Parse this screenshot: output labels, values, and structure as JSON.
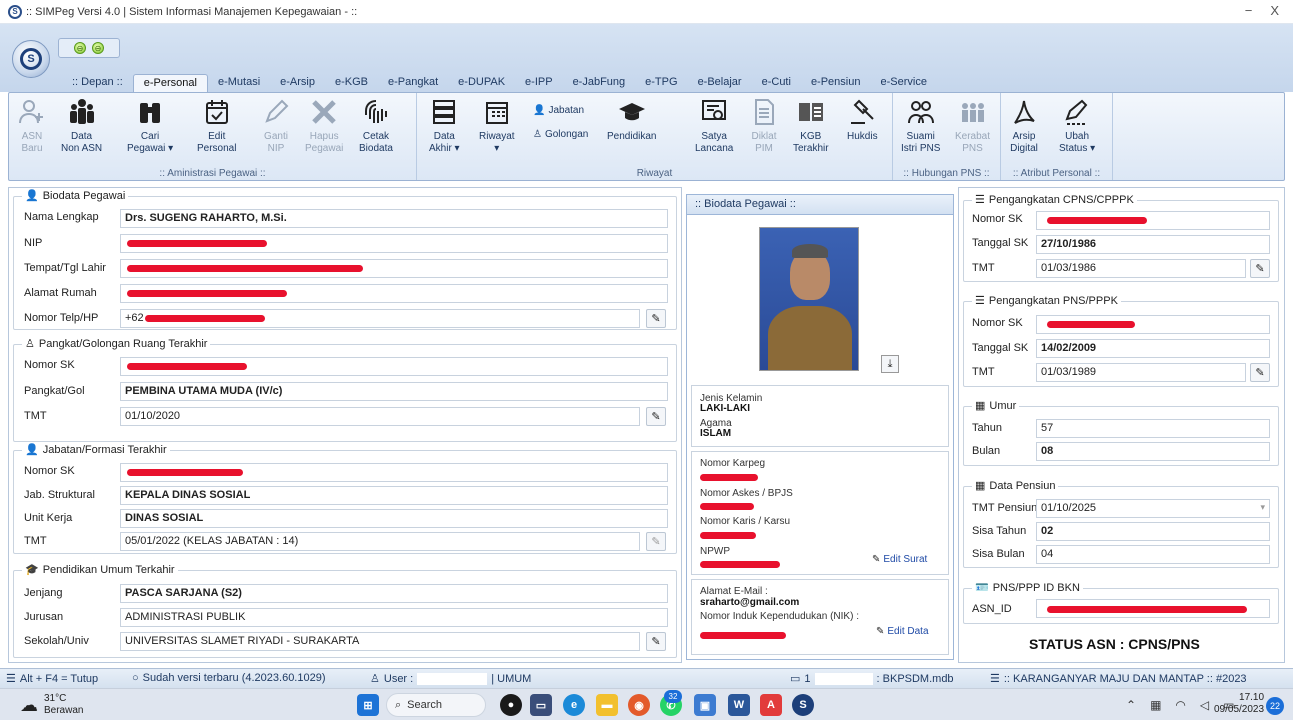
{
  "window": {
    "title": ":: SIMPeg Versi 4.0 | Sistem Informasi Manajemen Kepegawaian - ::",
    "minimize": "−",
    "close": "X"
  },
  "tabs": [
    ":: Depan ::",
    "e-Personal",
    "e-Mutasi",
    "e-Arsip",
    "e-KGB",
    "e-Pangkat",
    "e-DUPAK",
    "e-IPP",
    "e-JabFung",
    "e-TPG",
    "e-Belajar",
    "e-Cuti",
    "e-Pensiun",
    "e-Service"
  ],
  "ribbon": {
    "asn_baru": [
      "ASN",
      "Baru"
    ],
    "data_non_asn": [
      "Data",
      "Non ASN"
    ],
    "cari_pegawai": [
      "Cari",
      "Pegawai ▾"
    ],
    "edit_personal": [
      "Edit",
      "Personal"
    ],
    "ganti_nip": [
      "Ganti",
      "NIP"
    ],
    "hapus_pegawai": [
      "Hapus",
      "Pegawai"
    ],
    "cetak_biodata": [
      "Cetak",
      "Biodata"
    ],
    "data_akhir": [
      "Data",
      "Akhir ▾"
    ],
    "riwayat": [
      "Riwayat",
      "▾"
    ],
    "jabatan": "Jabatan",
    "golongan": "Golongan",
    "pendidikan": "Pendidikan",
    "satya_lancana": [
      "Satya",
      "Lancana"
    ],
    "diklat_pim": [
      "Diklat",
      "PIM"
    ],
    "kgb_terakhir": [
      "KGB",
      "Terakhir"
    ],
    "hukdis": "Hukdis",
    "suami_istri": [
      "Suami",
      "Istri PNS"
    ],
    "kerabat_pns": [
      "Kerabat",
      "PNS"
    ],
    "arsip_digital": [
      "Arsip",
      "Digital"
    ],
    "ubah_status": [
      "Ubah",
      "Status ▾"
    ],
    "group_admin": ":: Aministrasi Pegawai ::",
    "group_riwayat": "Riwayat",
    "group_hubungan": ":: Hubungan PNS ::",
    "group_atribut": ":: Atribut Personal ::"
  },
  "biodata": {
    "legend": "Biodata Pegawai",
    "nama_label": "Nama Lengkap",
    "nama_value": "Drs. SUGENG RAHARTO, M.Si.",
    "nip_label": "NIP",
    "ttl_label": "Tempat/Tgl Lahir",
    "alamat_label": "Alamat Rumah",
    "telp_label": "Nomor Telp/HP",
    "telp_prefix": "+62"
  },
  "pangkat": {
    "legend": "Pangkat/Golongan Ruang Terakhir",
    "sk_label": "Nomor SK",
    "gol_label": "Pangkat/Gol",
    "gol_value": "PEMBINA UTAMA MUDA (IV/c)",
    "tmt_label": "TMT",
    "tmt_value": "01/10/2020"
  },
  "jabatan": {
    "legend": "Jabatan/Formasi Terakhir",
    "sk_label": "Nomor SK",
    "struktural_label": "Jab. Struktural",
    "struktural_value": "KEPALA DINAS SOSIAL",
    "unit_label": "Unit Kerja",
    "unit_value": "DINAS SOSIAL",
    "tmt_label": "TMT",
    "tmt_value": "05/01/2022 (KELAS JABATAN : 14)"
  },
  "pendidikan": {
    "legend": "Pendidikan Umum Terkahir",
    "jenjang_label": "Jenjang",
    "jenjang_value": "PASCA SARJANA (S2)",
    "jurusan_label": "Jurusan",
    "jurusan_value": "ADMINISTRASI PUBLIK",
    "sekolah_label": "Sekolah/Univ",
    "sekolah_value": "UNIVERSITAS SLAMET RIYADI - SURAKARTA"
  },
  "profile": {
    "header": ":: Biodata Pegawai ::",
    "jk_label": "Jenis Kelamin",
    "jk_value": "LAKI-LAKI",
    "agama_label": "Agama",
    "agama_value": "ISLAM",
    "karpeg_label": "Nomor Karpeg",
    "askes_label": "Nomor Askes / BPJS",
    "karis_label": "Nomor Karis / Karsu",
    "npwp_label": "NPWP",
    "edit_surat": "Edit Surat",
    "email_label": "Alamat E-Mail :",
    "email_value": "sraharto@gmail.com",
    "nik_label": "Nomor Induk Kependudukan (NIK) :",
    "edit_data": "Edit Data"
  },
  "cpns": {
    "legend": "Pengangkatan CPNS/CPPPK",
    "sk_label": "Nomor SK",
    "tgl_label": "Tanggal SK",
    "tgl_value": "27/10/1986",
    "tmt_label": "TMT",
    "tmt_value": "01/03/1986"
  },
  "pns": {
    "legend": "Pengangkatan PNS/PPPK",
    "sk_label": "Nomor SK",
    "tgl_label": "Tanggal SK",
    "tgl_value": "14/02/2009",
    "tmt_label": "TMT",
    "tmt_value": "01/03/1989"
  },
  "umur": {
    "legend": "Umur",
    "tahun_label": "Tahun",
    "tahun_value": "57",
    "bulan_label": "Bulan",
    "bulan_value": "08"
  },
  "pensiun": {
    "legend": "Data Pensiun",
    "tmt_label": "TMT Pensiun",
    "tmt_value": "01/10/2025",
    "sisa_tahun_label": "Sisa Tahun",
    "sisa_tahun_value": "02",
    "sisa_bulan_label": "Sisa Bulan",
    "sisa_bulan_value": "04"
  },
  "bkn": {
    "legend": "PNS/PPP ID BKN",
    "asn_id_label": "ASN_ID"
  },
  "status_asn": "STATUS ASN : CPNS/PNS",
  "statusbar": {
    "exit": "Alt + F4 = Tutup",
    "version": "Sudah versi terbaru (4.2023.60.1029)",
    "user_label": "User :",
    "umum": "| UMUM",
    "db_prefix": "1",
    "db": ": BKPSDM.mdb",
    "motto": ":: KARANGANYAR MAJU DAN MANTAP :: #2023"
  },
  "taskbar": {
    "temp": "31°C",
    "weather": "Berawan",
    "search": "Search",
    "badge": "32",
    "time": "17.10",
    "date": "09/05/2023",
    "notif": "22"
  },
  "colors": {
    "redact": "#e8112d",
    "ribbon": "#dce7f5",
    "accent": "#1f3a62"
  }
}
